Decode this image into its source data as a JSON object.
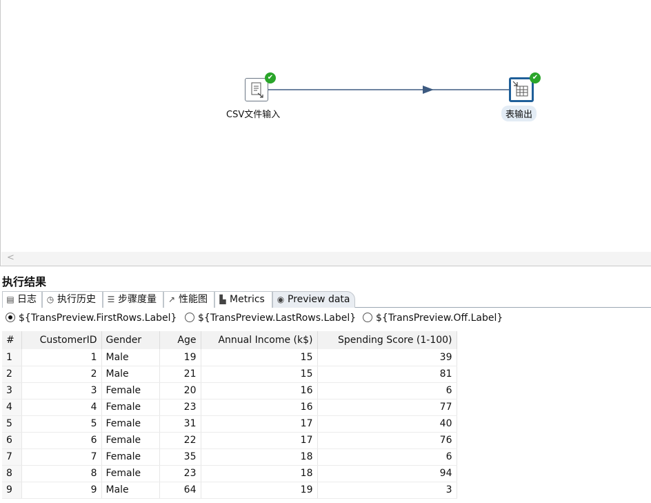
{
  "canvas": {
    "steps": [
      {
        "label": "CSV文件输入",
        "icon": "csv-file-input-icon",
        "status": "success"
      },
      {
        "label": "表输出",
        "icon": "table-output-icon",
        "status": "success"
      }
    ],
    "scroll_left_glyph": "<"
  },
  "results": {
    "title": "执行结果",
    "tabs": [
      {
        "label": "日志",
        "icon": "log-icon",
        "glyph": "▤"
      },
      {
        "label": "执行历史",
        "icon": "history-icon",
        "glyph": "◷"
      },
      {
        "label": "步骤度量",
        "icon": "step-metrics-icon",
        "glyph": "☰"
      },
      {
        "label": "性能图",
        "icon": "performance-chart-icon",
        "glyph": "↗"
      },
      {
        "label": "Metrics",
        "icon": "metrics-icon",
        "glyph": "▙"
      },
      {
        "label": "Preview data",
        "icon": "preview-eye-icon",
        "glyph": "◉",
        "active": true
      }
    ],
    "radios": [
      {
        "label": "${TransPreview.FirstRows.Label}",
        "selected": true
      },
      {
        "label": "${TransPreview.LastRows.Label}",
        "selected": false
      },
      {
        "label": "${TransPreview.Off.Label}",
        "selected": false
      }
    ],
    "table": {
      "columns": [
        "#",
        "CustomerID",
        "Gender",
        "Age",
        "Annual Income (k$)",
        "Spending Score (1-100)"
      ],
      "rows": [
        [
          "1",
          "1",
          "Male",
          "19",
          "15",
          "39"
        ],
        [
          "2",
          "2",
          "Male",
          "21",
          "15",
          "81"
        ],
        [
          "3",
          "3",
          "Female",
          "20",
          "16",
          "6"
        ],
        [
          "4",
          "4",
          "Female",
          "23",
          "16",
          "77"
        ],
        [
          "5",
          "5",
          "Female",
          "31",
          "17",
          "40"
        ],
        [
          "6",
          "6",
          "Female",
          "22",
          "17",
          "76"
        ],
        [
          "7",
          "7",
          "Female",
          "35",
          "18",
          "6"
        ],
        [
          "8",
          "8",
          "Female",
          "23",
          "18",
          "94"
        ],
        [
          "9",
          "9",
          "Male",
          "64",
          "19",
          "3"
        ]
      ]
    }
  },
  "colors": {
    "success": "#2aa52a",
    "hop": "#3d5a80",
    "selected_step_border": "#1f5f99"
  }
}
